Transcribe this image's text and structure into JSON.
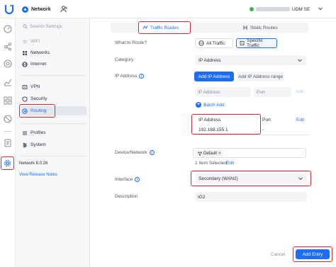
{
  "topbar": {
    "app_name": "Network",
    "device_name": "UDM SE"
  },
  "sidenav": {
    "search_placeholder": "Search Settings",
    "items": [
      {
        "label": "WiFi",
        "icon": "wifi-icon"
      },
      {
        "label": "Networks",
        "icon": "networks-icon"
      },
      {
        "label": "Internet",
        "icon": "globe-icon"
      },
      {
        "label": "VPN",
        "icon": "vpn-icon"
      },
      {
        "label": "Security",
        "icon": "shield-icon"
      },
      {
        "label": "Routing",
        "icon": "routing-icon"
      },
      {
        "label": "Profiles",
        "icon": "profiles-icon"
      },
      {
        "label": "System",
        "icon": "system-icon"
      }
    ],
    "version": "Network 8.0.26",
    "release_notes": "View Release Notes"
  },
  "tabs": {
    "traffic_routes": "Traffic Routes",
    "static_routes": "Static Routes"
  },
  "form": {
    "what_to_route_label": "What to Route?",
    "all_traffic": "All Traffic",
    "specific_traffic": "Specific Traffic",
    "category_label": "Category",
    "category_value": "IP Address",
    "ip_address_label": "IP Address",
    "add_ip_button": "Add IP Address",
    "add_ip_range_button": "Add IP Address range",
    "ip_placeholder": "IP Address",
    "port_placeholder": "Port",
    "add_link": "Add",
    "batch_add": "Batch Add",
    "entry_ip_header": "IP Address",
    "entry_port_header": "Port",
    "entry_edit": "Edit",
    "entry_ip_value": "192.168.155.1",
    "entry_port_value": "-",
    "device_network_label": "Device/Network",
    "device_chip": "Default",
    "selected_text": "1 Item Selected",
    "selected_edit": "Edit",
    "interface_label": "Interface",
    "interface_value": "Secondary (WAN2)",
    "description_label": "Description",
    "description_value": "IG2"
  },
  "footer": {
    "cancel": "Cancel",
    "add_entry": "Add Entry"
  },
  "colors": {
    "accent": "#1f6df2",
    "highlight": "#e4262c"
  }
}
